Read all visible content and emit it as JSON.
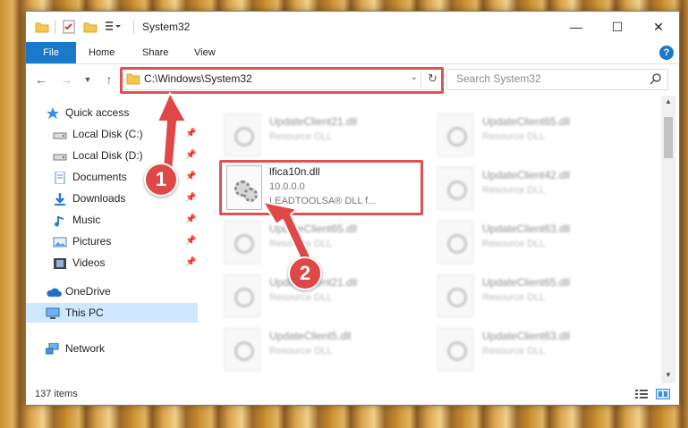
{
  "window": {
    "title": "System32",
    "controls": {
      "minimize": "—",
      "maximize": "☐",
      "close": "✕"
    }
  },
  "ribbon": {
    "tabs": [
      "File",
      "Home",
      "Share",
      "View"
    ],
    "help": "?"
  },
  "address": {
    "path": "C:\\Windows\\System32",
    "search_placeholder": "Search System32"
  },
  "navigation": {
    "quick_access": "Quick access",
    "items": [
      {
        "label": "Local Disk (C:)",
        "icon": "drive-icon",
        "pinned": true
      },
      {
        "label": "Local Disk (D:)",
        "icon": "drive-icon",
        "pinned": true
      },
      {
        "label": "Documents",
        "icon": "documents-icon",
        "pinned": true
      },
      {
        "label": "Downloads",
        "icon": "downloads-icon",
        "pinned": true
      },
      {
        "label": "Music",
        "icon": "music-icon",
        "pinned": true
      },
      {
        "label": "Pictures",
        "icon": "pictures-icon",
        "pinned": true
      },
      {
        "label": "Videos",
        "icon": "videos-icon",
        "pinned": true
      }
    ],
    "onedrive": "OneDrive",
    "this_pc": "This PC",
    "network": "Network"
  },
  "files": {
    "featured": {
      "name": "lfica10n.dll",
      "version": "10.0.0.0",
      "description": "LEADTOOLSA® DLL f..."
    },
    "blurred": [
      {
        "name": "UpdateClient21.dll",
        "type": "Resource DLL"
      },
      {
        "name": "UpdateClient65.dll",
        "type": "Resource DLL"
      },
      {
        "name": "UpdateClient42.dll",
        "type": "Resource DLL"
      },
      {
        "name": "UpdateClient65.dll",
        "type": "Resource DLL"
      },
      {
        "name": "UpdateClient63.dll",
        "type": "Resource DLL"
      },
      {
        "name": "UpdateClient21.dll",
        "type": "Resource DLL"
      },
      {
        "name": "UpdateClient65.dll",
        "type": "Resource DLL"
      },
      {
        "name": "UpdateClient5.dll",
        "type": "Resource DLL"
      },
      {
        "name": "UpdateClient63.dll",
        "type": "Resource DLL"
      }
    ]
  },
  "status": {
    "item_count": "137 items"
  },
  "annotations": {
    "step1": "1",
    "step2": "2"
  },
  "colors": {
    "accent": "#1979ca",
    "highlight": "#e05252",
    "selection": "#cde8ff"
  }
}
